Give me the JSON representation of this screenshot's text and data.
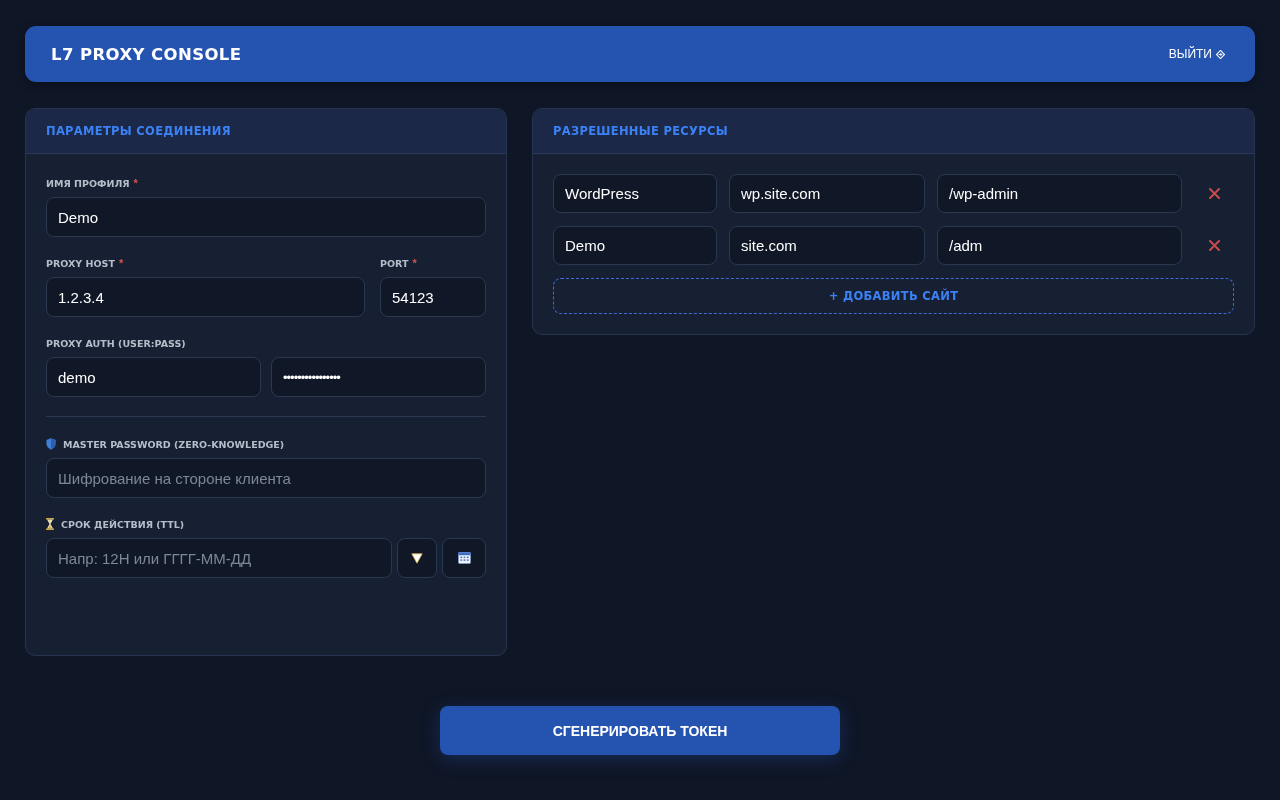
{
  "header": {
    "title": "L7 PROXY CONSOLE",
    "action": "ВЫЙТИ"
  },
  "connection": {
    "title": "ПАРАМЕТРЫ СОЕДИНЕНИЯ",
    "profile": {
      "label": "ИМЯ ПРОФИЛЯ",
      "mark": "*",
      "value": "Demo"
    },
    "host": {
      "label": "PROXY HOST",
      "mark": "*",
      "value": "1.2.3.4"
    },
    "port": {
      "label": "PORT",
      "mark": "*",
      "value": "54123"
    },
    "auth": {
      "label": "PROXY AUTH (USER:PASS)",
      "user": "demo",
      "password": "••••••••••••••••"
    },
    "master": {
      "label": "MASTER PASSWORD (ZERO-KNOWLEDGE)",
      "placeholder": "Шифрование на стороне клиента"
    },
    "ttl": {
      "label": "СРОК ДЕЙСТВИЯ (TTL)",
      "placeholder": "Напр: 12H или ГГГГ-ММ-ДД"
    }
  },
  "resources": {
    "title": "РАЗРЕШЕННЫЕ РЕСУРСЫ",
    "rows": [
      {
        "fields": [
          "WordPress",
          "wp.site.com",
          "/wp-admin"
        ]
      },
      {
        "fields": [
          "Demo",
          "site.com",
          "/adm"
        ]
      }
    ],
    "add_button": "+ ДОБАВИТЬ САЙТ"
  },
  "generate_button": "СГЕНЕРИРОВАТЬ ТОКЕН"
}
